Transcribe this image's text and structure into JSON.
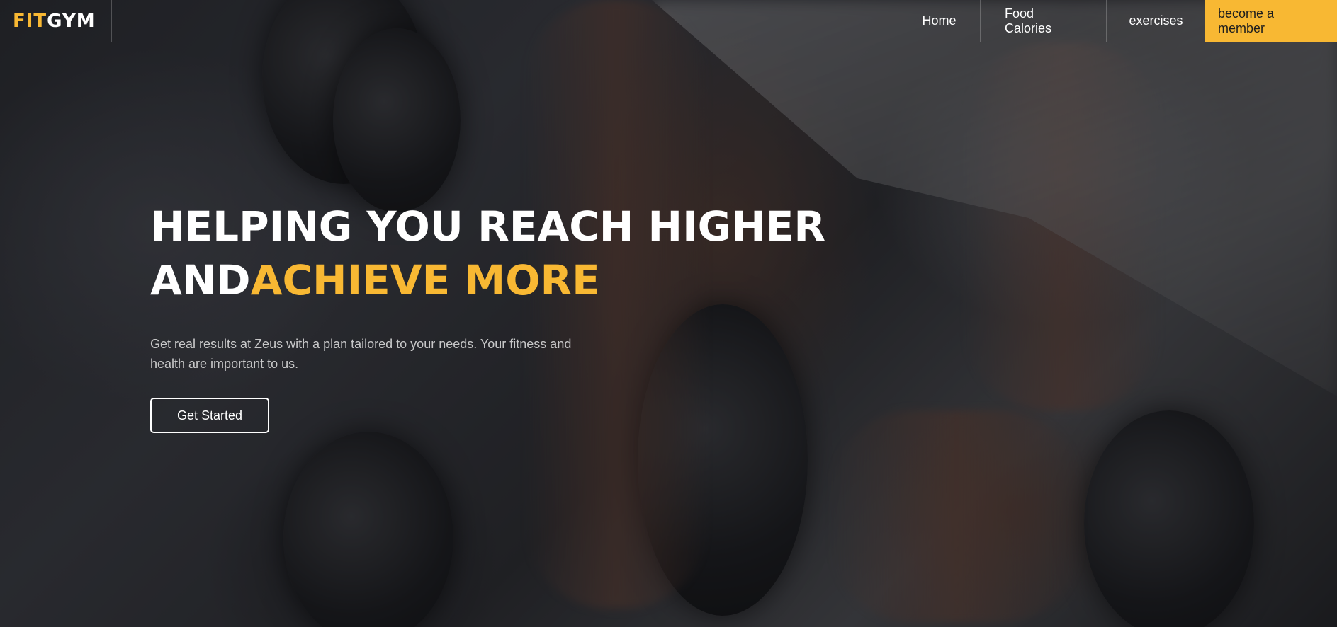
{
  "brand": {
    "logo_part1": "FIT",
    "logo_part2": "GYM",
    "accent_color": "#f8b833"
  },
  "nav": {
    "items": [
      {
        "label": "Home"
      },
      {
        "label": "Food Calories"
      },
      {
        "label": "exercises"
      }
    ],
    "cta_label": "become a member"
  },
  "hero": {
    "headline_line1": "HELPING YOU REACH HIGHER",
    "headline_line2_white": "AND",
    "headline_line2_accent": "ACHIEVE MORE",
    "subtext": "Get real results at Zeus with a plan tailored to your needs. Your fitness and health are important to us.",
    "button_label": "Get Started"
  }
}
